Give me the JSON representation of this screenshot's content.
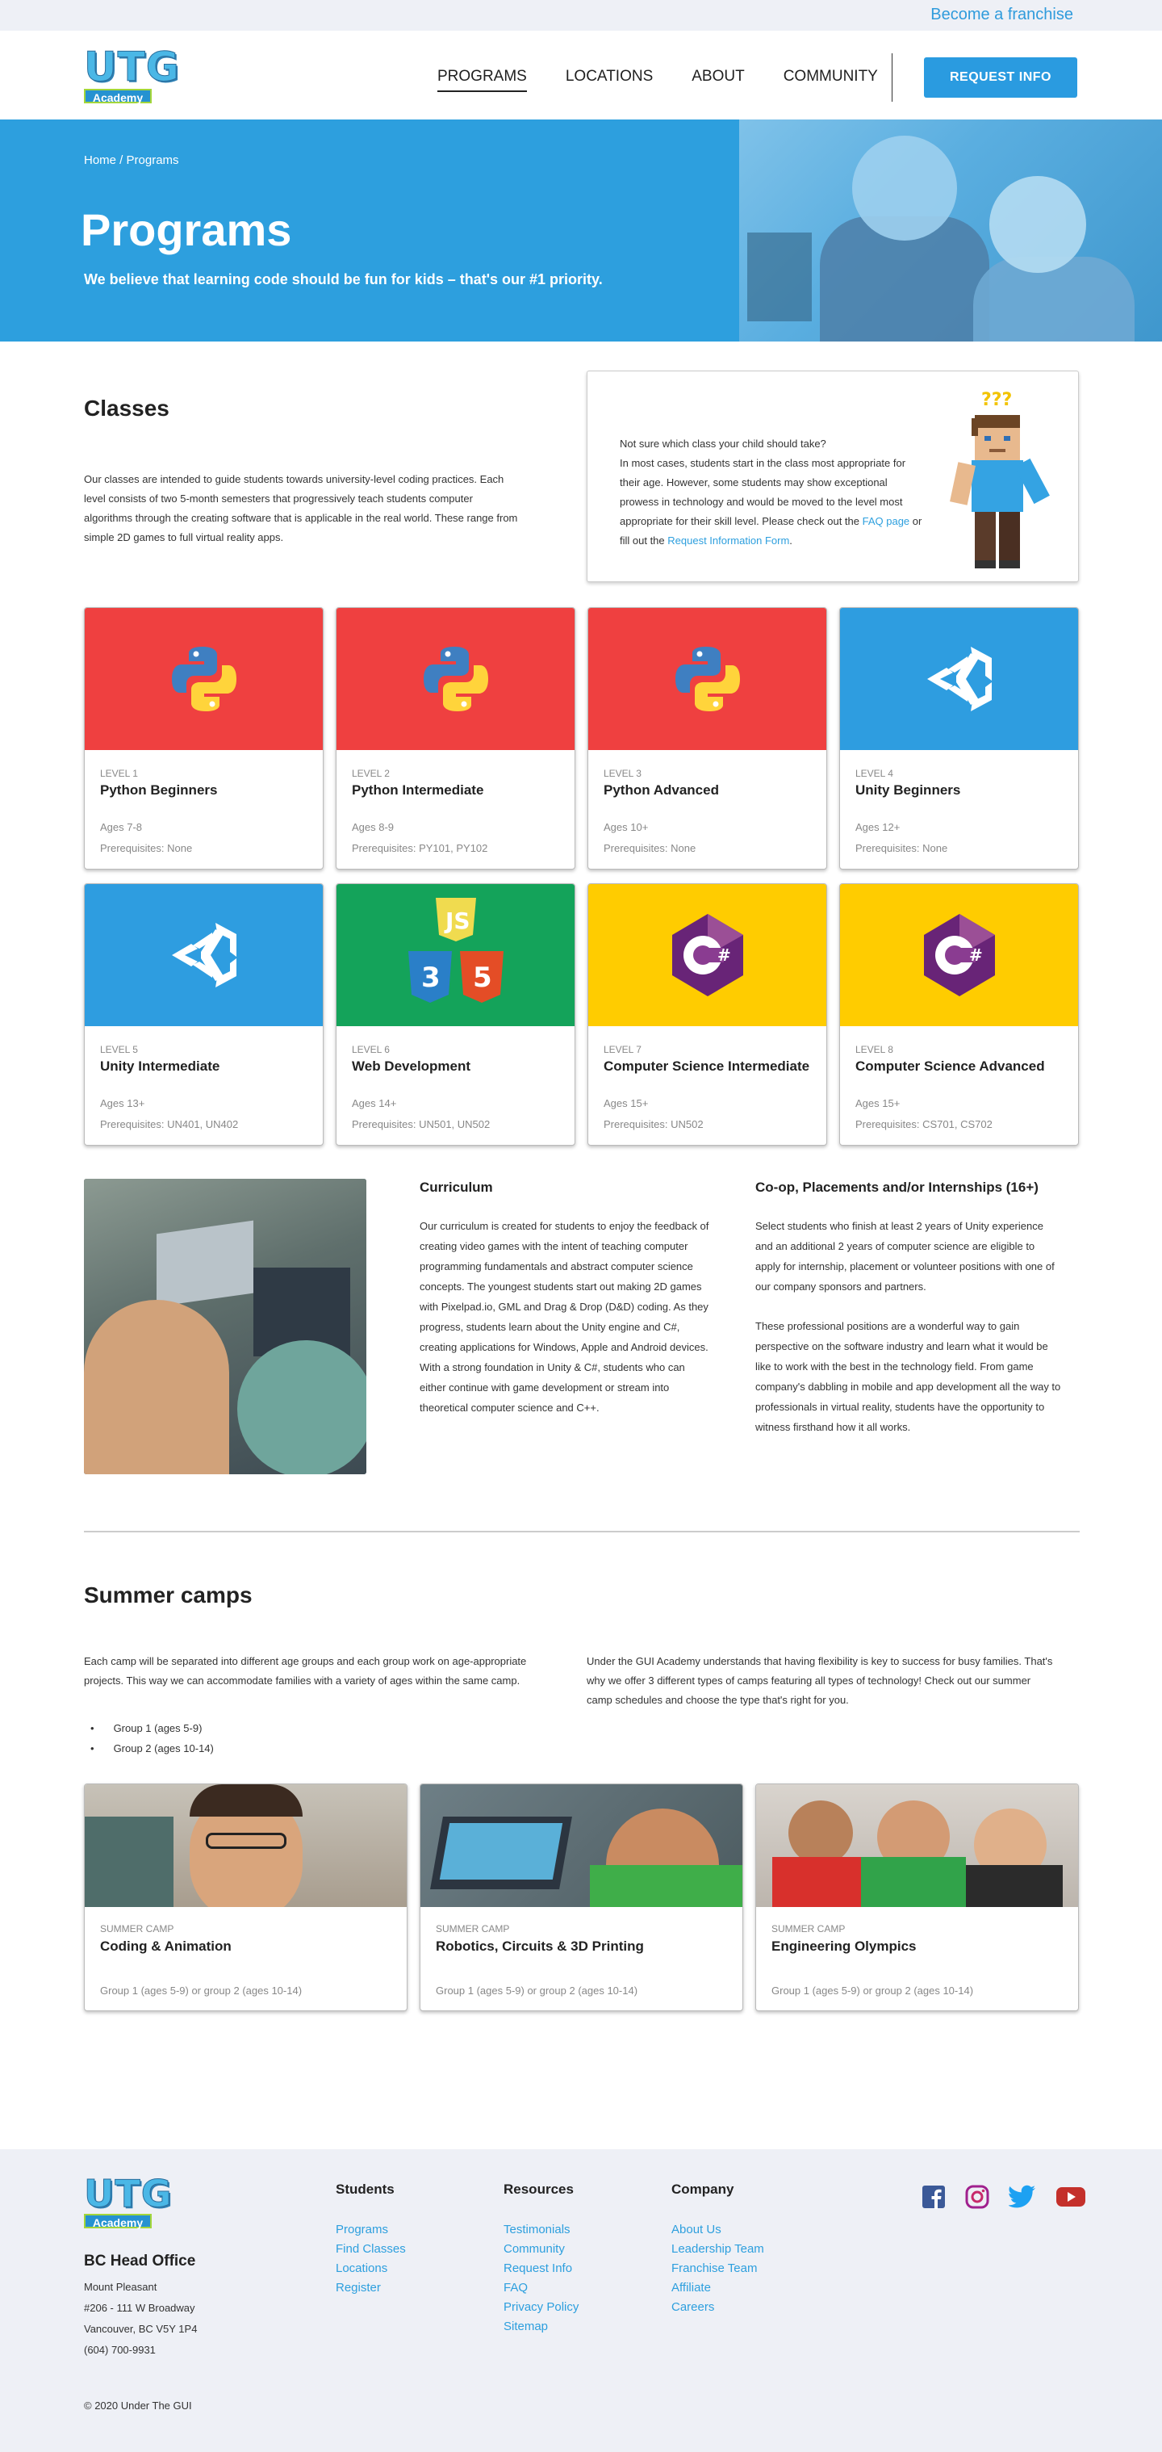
{
  "topbar": {
    "franchise_link": "Become a franchise"
  },
  "header": {
    "logo_letters": "UTG",
    "logo_badge": "Academy",
    "nav": [
      "PROGRAMS",
      "LOCATIONS",
      "ABOUT",
      "COMMUNITY"
    ],
    "request_button": "REQUEST INFO"
  },
  "hero": {
    "breadcrumb": "Home / Programs",
    "title": "Programs",
    "tagline": "We believe that learning code should be fun for kids – that's our #1 priority."
  },
  "classes": {
    "title": "Classes",
    "description": "Our classes are intended to guide students towards university-level coding practices. Each level consists of two 5-month semesters that progressively teach students computer algorithms through the creating software that is applicable in the real world. These range from simple 2D games to full virtual reality apps.",
    "info_box": {
      "line1": "Not sure which class your child should take?",
      "line2": "In most cases, students start in the class most appropriate for their age. However, some students may show exceptional prowess in technology and would be moved to the level most appropriate for their skill level. Please check out the ",
      "faq_link": "FAQ page",
      "line3": " or fill out the ",
      "form_link": "Request Information Form",
      "line4": "."
    },
    "cards": [
      {
        "level": "LEVEL 1",
        "name": "Python Beginners",
        "ages": "Ages 7-8",
        "prereq": "Prerequisites: None",
        "icon": "python-icon",
        "color": "#ef4040"
      },
      {
        "level": "LEVEL 2",
        "name": "Python Intermediate",
        "ages": "Ages 8-9",
        "prereq": "Prerequisites: PY101, PY102",
        "icon": "python-icon",
        "color": "#ef4040"
      },
      {
        "level": "LEVEL 3",
        "name": "Python Advanced",
        "ages": "Ages 10+",
        "prereq": "Prerequisites: None",
        "icon": "python-icon",
        "color": "#ef4040"
      },
      {
        "level": "LEVEL 4",
        "name": "Unity Beginners",
        "ages": "Ages 12+",
        "prereq": "Prerequisites: None",
        "icon": "unity-icon",
        "color": "#2e9de0"
      },
      {
        "level": "LEVEL 5",
        "name": "Unity Intermediate",
        "ages": "Ages 13+",
        "prereq": "Prerequisites: UN401, UN402",
        "icon": "unity-icon",
        "color": "#2e9de0"
      },
      {
        "level": "LEVEL 6",
        "name": "Web Development",
        "ages": "Ages 14+",
        "prereq": "Prerequisites: UN501, UN502",
        "icon": "html-css-js-icon",
        "color": "#14a35a"
      },
      {
        "level": "LEVEL 7",
        "name": "Computer Science Intermediate",
        "ages": "Ages 15+",
        "prereq": "Prerequisites: UN502",
        "icon": "csharp-icon",
        "color": "#ffcc00"
      },
      {
        "level": "LEVEL 8",
        "name": "Computer Science Advanced",
        "ages": "Ages 15+",
        "prereq": "Prerequisites: CS701, CS702",
        "icon": "csharp-icon",
        "color": "#ffcc00"
      }
    ]
  },
  "curriculum": {
    "title": "Curriculum",
    "text": "Our curriculum is created for students to enjoy the feedback of creating video games with the intent of teaching computer programming fundamentals and abstract computer science concepts. The youngest students start out making 2D games with Pixelpad.io, GML and Drag & Drop (D&D) coding. As they progress, students learn about the Unity engine and C#, creating applications for Windows, Apple and Android devices. With a strong foundation in Unity & C#, students who can either continue with game development or stream into theoretical computer science and C++."
  },
  "coop": {
    "title": "Co-op, Placements and/or Internships (16+)",
    "text1": "Select students who finish at least 2 years of Unity experience and an additional 2 years of computer science are eligible to apply for internship, placement or volunteer positions with one of our company sponsors and partners.",
    "text2": "These professional positions are a wonderful way to gain perspective on the software industry and learn what it would be like to work with the best in the technology field. From game company's dabbling in mobile and app development all the way to professionals in virtual reality, students have the opportunity to witness firsthand how it all works."
  },
  "summer": {
    "title": "Summer camps",
    "text1": "Each camp will be separated into different age groups and each group work on age-appropriate projects. This way we can accommodate families with a variety of ages within the same camp.",
    "groups": [
      "Group 1 (ages 5-9)",
      "Group 2 (ages 10-14)"
    ],
    "text2": "Under the GUI Academy understands that having flexibility is key to success for busy families. That's why we offer 3 different types of camps featuring all types of technology! Check out our summer camp schedules and choose the type that's right for you.",
    "camps": [
      {
        "label": "SUMMER CAMP",
        "name": "Coding & Animation",
        "groups": "Group 1 (ages 5-9) or group 2 (ages 10-14)"
      },
      {
        "label": "SUMMER CAMP",
        "name": "Robotics, Circuits & 3D Printing",
        "groups": "Group 1 (ages 5-9) or group 2 (ages 10-14)"
      },
      {
        "label": "SUMMER CAMP",
        "name": "Engineering Olympics",
        "groups": "Group 1 (ages 5-9) or group 2 (ages 10-14)"
      }
    ]
  },
  "footer": {
    "office_title": "BC Head Office",
    "address": [
      "Mount Pleasant",
      "#206 - 111 W Broadway",
      "Vancouver, BC V5Y 1P4",
      "(604) 700-9931"
    ],
    "students": {
      "title": "Students",
      "links": [
        "Programs",
        "Find Classes",
        "Locations",
        "Register"
      ]
    },
    "resources": {
      "title": "Resources",
      "links": [
        "Testimonials",
        "Community",
        "Request Info",
        "FAQ",
        "Privacy Policy",
        "Sitemap"
      ]
    },
    "company": {
      "title": "Company",
      "links": [
        "About Us",
        "Leadership Team",
        "Franchise Team",
        "Affiliate",
        "Careers"
      ]
    },
    "social": [
      "facebook-icon",
      "instagram-icon",
      "twitter-icon",
      "youtube-icon"
    ],
    "copyright": "© 2020 Under The GUI"
  }
}
